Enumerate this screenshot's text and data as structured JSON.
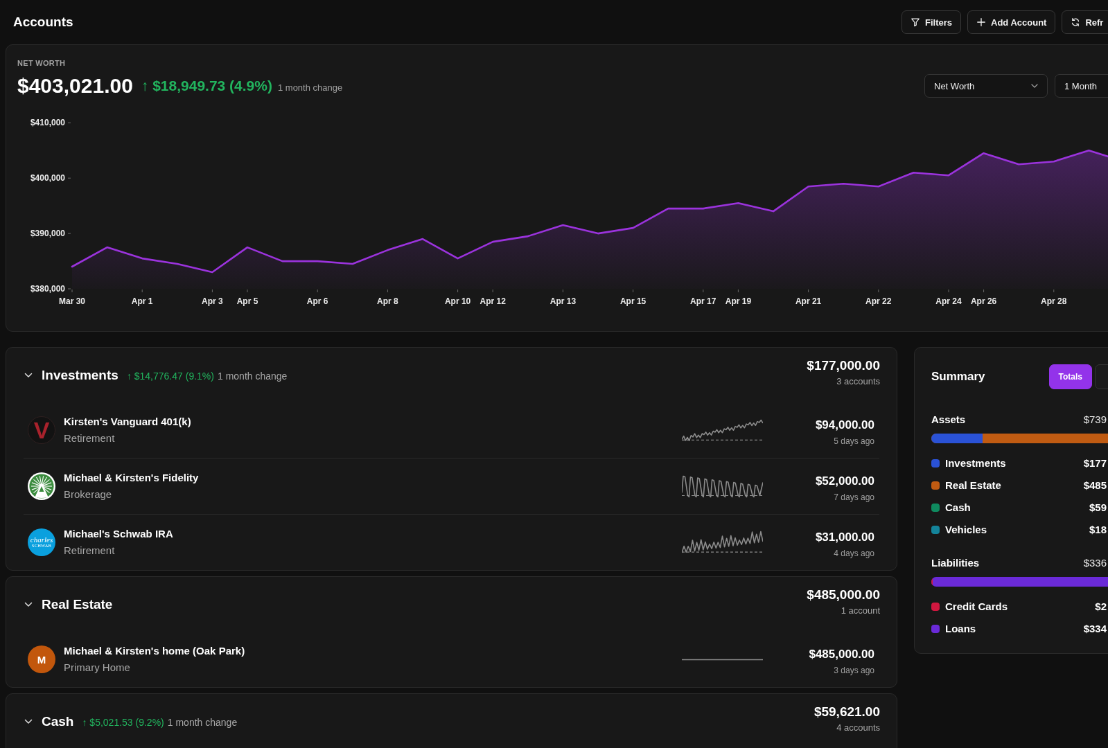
{
  "header": {
    "title": "Accounts",
    "buttons": [
      {
        "kind": "filter",
        "label": "Filters"
      },
      {
        "kind": "add",
        "label": "Add Account"
      },
      {
        "kind": "refresh",
        "label": "Refr"
      }
    ]
  },
  "net_worth": {
    "label": "NET WORTH",
    "value": "$403,021.00",
    "change": "↑ $18,949.73 (4.9%)",
    "change_period": "1 month change",
    "selects": [
      {
        "value": "Net Worth"
      },
      {
        "value": "1 Month"
      }
    ],
    "chart_data": {
      "type": "area",
      "categories": [
        "Mar 30",
        null,
        "Apr 1",
        null,
        "Apr 3",
        "Apr 5",
        null,
        "Apr 6",
        null,
        "Apr 8",
        null,
        "Apr 10",
        "Apr 12",
        null,
        "Apr 13",
        null,
        "Apr 15",
        null,
        "Apr 17",
        "Apr 19",
        null,
        "Apr 21",
        null,
        "Apr 22",
        null,
        "Apr 24",
        "Apr 26",
        null,
        "Apr 28",
        null,
        null
      ],
      "ylim": [
        380000,
        410000
      ],
      "yticks": [
        {
          "value": 380000,
          "label": "$380,000"
        },
        {
          "value": 390000,
          "label": "$390,000"
        },
        {
          "value": 400000,
          "label": "$400,000"
        },
        {
          "value": 410000,
          "label": "$410,000"
        }
      ],
      "series": [
        {
          "color": "#9b33dd",
          "values": [
            384000,
            387500,
            385500,
            384500,
            383000,
            387500,
            385000,
            385000,
            384500,
            387000,
            389000,
            385500,
            388500,
            389500,
            391500,
            390000,
            391000,
            394500,
            394500,
            395500,
            394000,
            398500,
            399000,
            398500,
            401000,
            400500,
            404500,
            402500,
            403000,
            405000,
            403000
          ]
        }
      ]
    }
  },
  "groups": [
    {
      "name": "Investments",
      "expanded": true,
      "change": "↑ $14,776.47 (9.1%)",
      "change_period": "1 month change",
      "total": "$177,000.00",
      "count": "3 accounts",
      "accounts": [
        {
          "name": "Kirsten's Vanguard 401(k)",
          "type": "Retirement",
          "logo": {
            "kind": "letter",
            "text": "V"
          },
          "sparkline": {
            "kind": "rising"
          },
          "value": "$94,000.00",
          "updated": "5 days ago"
        },
        {
          "name": "Michael & Kirsten's Fidelity",
          "type": "Brokerage",
          "logo": {
            "kind": "starburst"
          },
          "sparkline": {
            "kind": "wave"
          },
          "value": "$52,000.00",
          "updated": "7 days ago"
        },
        {
          "name": "Michael's Schwab IRA",
          "type": "Retirement",
          "logo": {
            "kind": "wordmark",
            "lines": [
              "charles",
              "SCHWAB"
            ]
          },
          "sparkline": {
            "kind": "noisy"
          },
          "value": "$31,000.00",
          "updated": "4 days ago"
        }
      ]
    },
    {
      "name": "Real Estate",
      "expanded": true,
      "total": "$485,000.00",
      "count": "1 account",
      "accounts": [
        {
          "name": "Michael & Kirsten's home (Oak Park)",
          "type": "Primary Home",
          "logo": {
            "kind": "initial",
            "text": "M"
          },
          "sparkline": {
            "kind": "flat"
          },
          "value": "$485,000.00",
          "updated": "3 days ago"
        }
      ]
    },
    {
      "name": "Cash",
      "expanded": true,
      "change": "↑ $5,021.53 (9.2%)",
      "change_period": "1 month change",
      "total": "$59,621.00",
      "count": "4 accounts"
    }
  ],
  "summary": {
    "title": "Summary",
    "tabs": [
      {
        "label": "Totals",
        "selected": true
      },
      {
        "selected": false
      }
    ],
    "sections": [
      {
        "name": "Assets",
        "total": "$739",
        "level": 0.29,
        "items": [
          {
            "name": "Investments",
            "value": "$177",
            "color": "#2a52d6"
          },
          {
            "name": "Real Estate",
            "value": "$485",
            "color": "#c05b12"
          },
          {
            "name": "Cash",
            "value": "$59",
            "color": "#0f8a5f"
          },
          {
            "name": "Vehicles",
            "value": "$18",
            "color": "#14849a"
          }
        ]
      },
      {
        "name": "Liabilities",
        "total": "$336",
        "level": 0.008,
        "items": [
          {
            "name": "Credit Cards",
            "value": "$2",
            "color": "#d0173f"
          },
          {
            "name": "Loans",
            "value": "$334",
            "color": "#6a2ad8"
          }
        ]
      }
    ]
  }
}
